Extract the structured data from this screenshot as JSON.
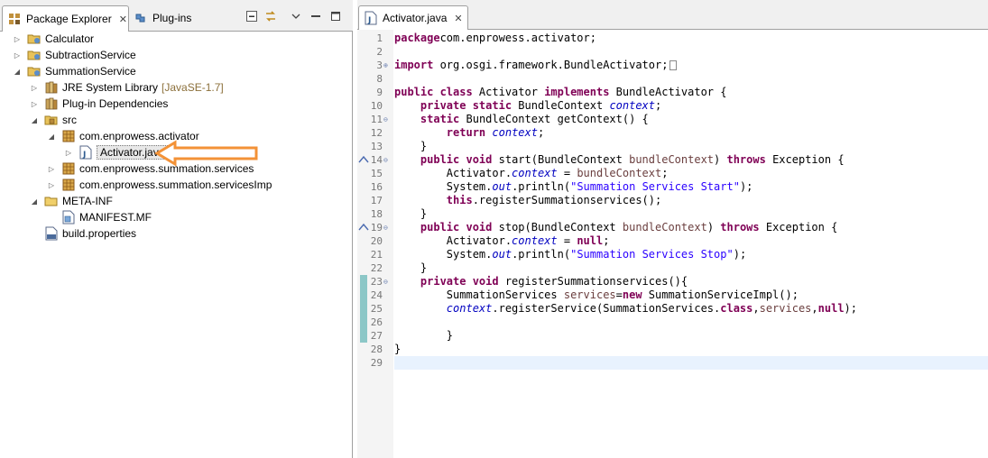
{
  "explorer": {
    "tabs": [
      {
        "label": "Package Explorer",
        "close": "✕"
      },
      {
        "label": "Plug-ins"
      }
    ],
    "tree": {
      "calculator": "Calculator",
      "subtraction": "SubtractionService",
      "summation": "SummationService",
      "jre": "JRE System Library",
      "jre_version": "[JavaSE-1.7]",
      "plugin_deps": "Plug-in Dependencies",
      "src": "src",
      "pkg_activator": "com.enprowess.activator",
      "activator_java": "Activator.java",
      "pkg_services": "com.enprowess.summation.services",
      "pkg_servicesimp": "com.enprowess.summation.servicesImp",
      "meta_inf": "META-INF",
      "manifest": "MANIFEST.MF",
      "build_props": "build.properties"
    },
    "annotation": {
      "arrow_color": "#f39237"
    }
  },
  "editor": {
    "tab_label": "Activator.java",
    "tab_close": "✕",
    "lines": [
      {
        "n": "1",
        "fold": "",
        "html": [
          [
            "kw",
            "package"
          ],
          [
            "",
            "com.enprowess.activator;"
          ]
        ]
      },
      {
        "n": "2",
        "fold": "",
        "html": []
      },
      {
        "n": "3",
        "fold": "plus",
        "html": [
          [
            "kw",
            "import"
          ],
          [
            "",
            " org.osgi.framework.BundleActivator;"
          ],
          [
            "box",
            "…"
          ]
        ]
      },
      {
        "n": "8",
        "fold": "",
        "html": []
      },
      {
        "n": "9",
        "fold": "",
        "html": [
          [
            "kw",
            "public class"
          ],
          [
            "",
            " Activator "
          ],
          [
            "kw",
            "implements"
          ],
          [
            "",
            " BundleActivator {"
          ]
        ]
      },
      {
        "n": "10",
        "fold": "",
        "html": [
          [
            "",
            "    "
          ],
          [
            "kw",
            "private static"
          ],
          [
            "",
            " BundleContext "
          ],
          [
            "fld",
            "context"
          ],
          [
            "",
            ";"
          ]
        ]
      },
      {
        "n": "11",
        "fold": "minus",
        "html": [
          [
            "",
            "    "
          ],
          [
            "kw",
            "static"
          ],
          [
            "",
            " BundleContext getContext() {"
          ]
        ]
      },
      {
        "n": "12",
        "fold": "",
        "html": [
          [
            "",
            "        "
          ],
          [
            "kw",
            "return"
          ],
          [
            "",
            " "
          ],
          [
            "fld",
            "context"
          ],
          [
            "",
            ";"
          ]
        ]
      },
      {
        "n": "13",
        "fold": "",
        "html": [
          [
            "",
            "    }"
          ]
        ]
      },
      {
        "n": "14",
        "fold": "minus",
        "html": [
          [
            "",
            "    "
          ],
          [
            "kw",
            "public void"
          ],
          [
            "",
            " start(BundleContext "
          ],
          [
            "par",
            "bundleContext"
          ],
          [
            "",
            ") "
          ],
          [
            "kw",
            "throws"
          ],
          [
            "",
            " Exception {"
          ]
        ]
      },
      {
        "n": "15",
        "fold": "",
        "html": [
          [
            "",
            "        Activator."
          ],
          [
            "fld",
            "context"
          ],
          [
            "",
            " = "
          ],
          [
            "par",
            "bundleContext"
          ],
          [
            "",
            ";"
          ]
        ]
      },
      {
        "n": "16",
        "fold": "",
        "html": [
          [
            "",
            "        System."
          ],
          [
            "fld",
            "out"
          ],
          [
            "",
            ".println("
          ],
          [
            "str",
            "\"Summation Services Start\""
          ],
          [
            "",
            ");"
          ]
        ]
      },
      {
        "n": "17",
        "fold": "",
        "html": [
          [
            "",
            "        "
          ],
          [
            "kw",
            "this"
          ],
          [
            "",
            ".registerSummationservices();"
          ]
        ]
      },
      {
        "n": "18",
        "fold": "",
        "html": [
          [
            "",
            "    }"
          ]
        ]
      },
      {
        "n": "19",
        "fold": "minus",
        "html": [
          [
            "",
            "    "
          ],
          [
            "kw",
            "public void"
          ],
          [
            "",
            " stop(BundleContext "
          ],
          [
            "par",
            "bundleContext"
          ],
          [
            "",
            ") "
          ],
          [
            "kw",
            "throws"
          ],
          [
            "",
            " Exception {"
          ]
        ]
      },
      {
        "n": "20",
        "fold": "",
        "html": [
          [
            "",
            "        Activator."
          ],
          [
            "fld",
            "context"
          ],
          [
            "",
            " = "
          ],
          [
            "kw",
            "null"
          ],
          [
            "",
            ";"
          ]
        ]
      },
      {
        "n": "21",
        "fold": "",
        "html": [
          [
            "",
            "        System."
          ],
          [
            "fld",
            "out"
          ],
          [
            "",
            ".println("
          ],
          [
            "str",
            "\"Summation Services Stop\""
          ],
          [
            "",
            ");"
          ]
        ]
      },
      {
        "n": "22",
        "fold": "",
        "html": [
          [
            "",
            "    }"
          ]
        ]
      },
      {
        "n": "23",
        "fold": "minus",
        "html": [
          [
            "",
            "    "
          ],
          [
            "kw",
            "private void"
          ],
          [
            "",
            " registerSummationservices(){"
          ]
        ]
      },
      {
        "n": "24",
        "fold": "",
        "html": [
          [
            "",
            "        SummationServices "
          ],
          [
            "par",
            "services"
          ],
          [
            "",
            "="
          ],
          [
            "kw",
            "new"
          ],
          [
            "",
            " SummationServiceImpl();"
          ]
        ]
      },
      {
        "n": "25",
        "fold": "",
        "html": [
          [
            "",
            "        "
          ],
          [
            "fld",
            "context"
          ],
          [
            "",
            ".registerService(SummationServices."
          ],
          [
            "kw",
            "class"
          ],
          [
            "",
            ","
          ],
          [
            "par",
            "services"
          ],
          [
            "",
            ","
          ],
          [
            "kw",
            "null"
          ],
          [
            "",
            ");"
          ]
        ]
      },
      {
        "n": "26",
        "fold": "",
        "html": []
      },
      {
        "n": "27",
        "fold": "",
        "html": [
          [
            "",
            "        }"
          ]
        ]
      },
      {
        "n": "28",
        "fold": "",
        "html": [
          [
            "",
            "}"
          ]
        ]
      },
      {
        "n": "29",
        "fold": "",
        "html": []
      }
    ],
    "override_markers": [
      "14",
      "19"
    ],
    "changed_lines": [
      "23",
      "24",
      "25",
      "26",
      "27"
    ],
    "current_line": "29"
  }
}
